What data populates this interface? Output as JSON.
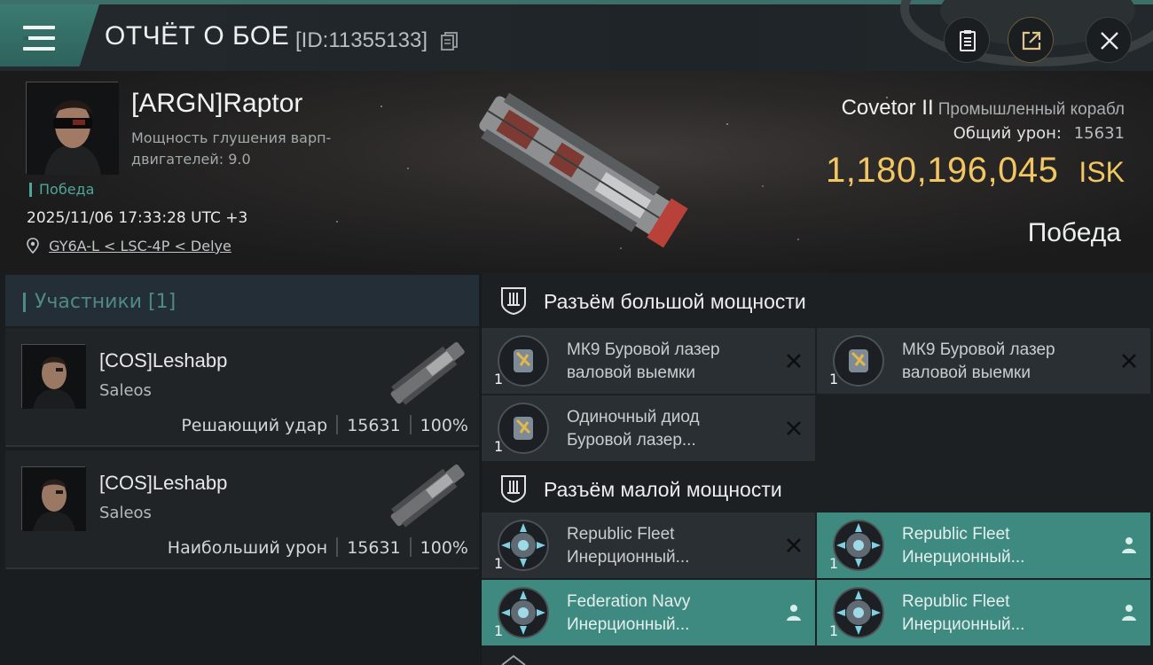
{
  "header": {
    "title": "ОТЧЁТ О БОЕ",
    "report_id": "[ID:11355133]",
    "buttons": {
      "report_icon": "clipboard-icon",
      "share_icon": "share-icon",
      "close_icon": "close-icon"
    }
  },
  "victim": {
    "pilot_name": "[ARGN]Raptor",
    "attribute": "Мощность глушения варп-двигателей: 9.0",
    "outcome_tag": "Победа",
    "datetime": "2025/11/06 17:33:28 UTC +3",
    "location": "GY6A-L < LSC-4P < Delye",
    "ship_name": "Covetor II",
    "ship_class": "Промышленный корабл",
    "total_damage_label": "Общий урон:",
    "total_damage": "15631",
    "isk_value": "1,180,196,045",
    "isk_unit": "ISK",
    "result": "Победа"
  },
  "participants": {
    "title": "Участники [1]",
    "list": [
      {
        "name": "[COS]Leshabp",
        "ship": "Saleos",
        "role": "Решающий удар",
        "damage": "15631",
        "percent": "100%"
      },
      {
        "name": "[COS]Leshabp",
        "ship": "Saleos",
        "role": "Наибольший урон",
        "damage": "15631",
        "percent": "100%"
      }
    ]
  },
  "fitting": {
    "high_slots": {
      "title": "Разъём большой мощности",
      "modules": [
        {
          "name_line1": "МК9 Буровой лазер",
          "name_line2": "валовой выемки",
          "qty": "1",
          "state": "destroyed"
        },
        {
          "name_line1": "МК9 Буровой лазер",
          "name_line2": "валовой выемки",
          "qty": "1",
          "state": "destroyed"
        },
        {
          "name_line1": "Одиночный диод",
          "name_line2": "Буровой лазер...",
          "qty": "1",
          "state": "destroyed"
        }
      ]
    },
    "low_slots": {
      "title": "Разъём малой мощности",
      "modules": [
        {
          "name_line1": "Republic Fleet",
          "name_line2": "Инерционный...",
          "qty": "1",
          "state": "destroyed"
        },
        {
          "name_line1": "Republic Fleet",
          "name_line2": "Инерционный...",
          "qty": "1",
          "state": "dropped"
        },
        {
          "name_line1": "Federation Navy",
          "name_line2": "Инерционный...",
          "qty": "1",
          "state": "dropped"
        },
        {
          "name_line1": "Republic Fleet",
          "name_line2": "Инерционный...",
          "qty": "1",
          "state": "dropped"
        }
      ]
    }
  },
  "colors": {
    "accent_teal": "#3f8a80",
    "isk_gold": "#f2c661",
    "victory_green": "#4fa79a"
  }
}
